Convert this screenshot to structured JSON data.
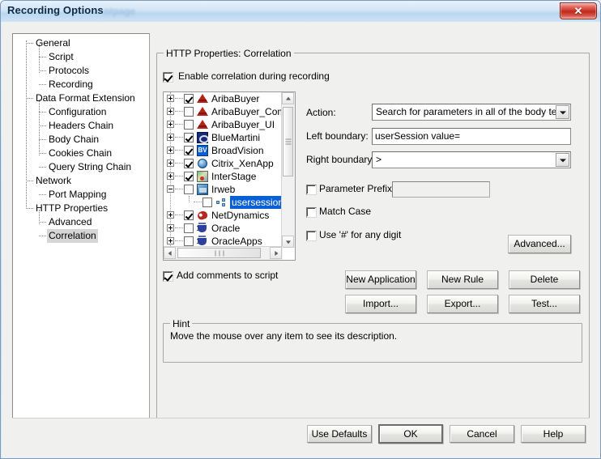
{
  "window": {
    "title": "Recording Options",
    "ghost_title": "ntpage",
    "close_icon": "close-icon",
    "close_glyph": "✕"
  },
  "nav_tree": {
    "items": [
      {
        "label": "General",
        "level": 0,
        "selected": false
      },
      {
        "label": "Script",
        "level": 1,
        "selected": false
      },
      {
        "label": "Protocols",
        "level": 1,
        "selected": false
      },
      {
        "label": "Recording",
        "level": 1,
        "selected": false
      },
      {
        "label": "Data Format Extension",
        "level": 0,
        "selected": false
      },
      {
        "label": "Configuration",
        "level": 1,
        "selected": false
      },
      {
        "label": "Headers Chain",
        "level": 1,
        "selected": false
      },
      {
        "label": "Body Chain",
        "level": 1,
        "selected": false
      },
      {
        "label": "Cookies Chain",
        "level": 1,
        "selected": false
      },
      {
        "label": "Query String Chain",
        "level": 1,
        "selected": false
      },
      {
        "label": "Network",
        "level": 0,
        "selected": false
      },
      {
        "label": "Port Mapping",
        "level": 1,
        "selected": false
      },
      {
        "label": "HTTP Properties",
        "level": 0,
        "selected": false
      },
      {
        "label": "Advanced",
        "level": 1,
        "selected": false
      },
      {
        "label": "Correlation",
        "level": 1,
        "selected": true
      }
    ]
  },
  "http_group": {
    "title": "HTTP Properties: Correlation",
    "enable_checkbox": {
      "label": "Enable correlation during recording",
      "checked": true
    }
  },
  "app_list": {
    "rows": [
      {
        "name": "AribaBuyer",
        "checked": true,
        "expander": "plus",
        "icon": "ariba-icon",
        "child": false,
        "selected": false
      },
      {
        "name": "AribaBuyer_Comm",
        "checked": false,
        "expander": "plus",
        "icon": "ariba-icon",
        "child": false,
        "selected": false
      },
      {
        "name": "AribaBuyer_UI",
        "checked": false,
        "expander": "plus",
        "icon": "ariba-icon",
        "child": false,
        "selected": false
      },
      {
        "name": "BlueMartini",
        "checked": true,
        "expander": "plus",
        "icon": "bluemartini-icon",
        "child": false,
        "selected": false
      },
      {
        "name": "BroadVision",
        "checked": true,
        "expander": "plus",
        "icon": "broadvision-icon",
        "child": false,
        "selected": false
      },
      {
        "name": "Citrix_XenApp",
        "checked": true,
        "expander": "plus",
        "icon": "citrix-icon",
        "child": false,
        "selected": false
      },
      {
        "name": "InterStage",
        "checked": true,
        "expander": "plus",
        "icon": "interstage-icon",
        "child": false,
        "selected": false
      },
      {
        "name": "Irweb",
        "checked": false,
        "expander": "minus",
        "icon": "irweb-icon",
        "child": false,
        "selected": false
      },
      {
        "name": "usersessionid",
        "checked": false,
        "expander": "none",
        "icon": "rule-node-icon",
        "child": true,
        "selected": true
      },
      {
        "name": "NetDynamics",
        "checked": true,
        "expander": "plus",
        "icon": "netdynamics-icon",
        "child": false,
        "selected": false
      },
      {
        "name": "Oracle",
        "checked": false,
        "expander": "plus",
        "icon": "oracle-icon",
        "child": false,
        "selected": false
      },
      {
        "name": "OracleApps",
        "checked": false,
        "expander": "plus",
        "icon": "oracle-icon",
        "child": false,
        "selected": false
      }
    ],
    "scrollbar_vertical": "vertical-scrollbar",
    "scrollbar_horizontal": "horizontal-scrollbar"
  },
  "rule_form": {
    "action_label": "Action:",
    "action_value": "Search for parameters in all of the body text",
    "left_boundary_label": "Left boundary:",
    "left_boundary_value": "userSession value=",
    "right_boundary_label": "Right boundary:",
    "right_boundary_value": ">",
    "parameter_prefix_label": "Parameter Prefix:",
    "parameter_prefix_value": "",
    "parameter_prefix_checked": false,
    "match_case_label": "Match Case",
    "match_case_checked": false,
    "any_digit_label": "Use '#' for any digit",
    "any_digit_checked": false,
    "advanced_button": "Advanced..."
  },
  "actions": {
    "add_comments_label": "Add comments to script",
    "add_comments_checked": true,
    "new_application": "New Application",
    "new_rule": "New Rule",
    "delete": "Delete",
    "import": "Import...",
    "export": "Export...",
    "test": "Test..."
  },
  "hint": {
    "title": "Hint",
    "text": "Move the mouse over any item to see its description."
  },
  "footer": {
    "use_defaults": "Use Defaults",
    "ok": "OK",
    "cancel": "Cancel",
    "help": "Help"
  },
  "colors": {
    "selection_blue": "#0a5fd4",
    "title_gradient_top": "#e8f2fb",
    "title_gradient_bottom": "#cfe3f5",
    "close_red": "#c0281c",
    "dialog_face": "#f0f0ee"
  }
}
